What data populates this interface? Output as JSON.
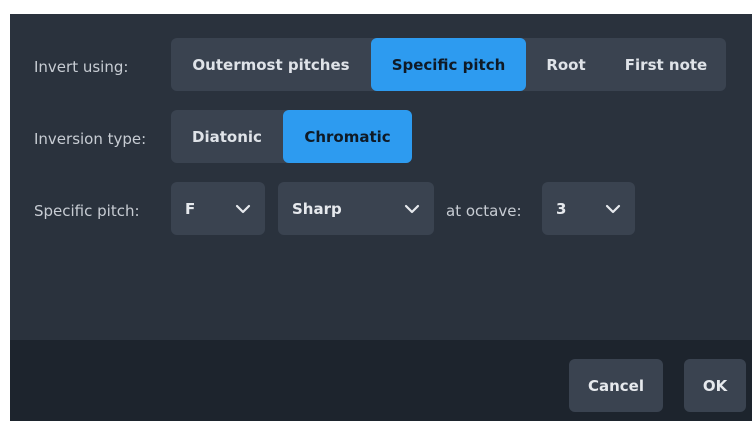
{
  "invert_using": {
    "label": "Invert using:",
    "options": [
      "Outermost pitches",
      "Specific pitch",
      "Root",
      "First note"
    ],
    "selected": "Specific pitch"
  },
  "inversion_type": {
    "label": "Inversion type:",
    "options": [
      "Diatonic",
      "Chromatic"
    ],
    "selected": "Chromatic"
  },
  "specific_pitch": {
    "label": "Specific pitch:",
    "note_value": "F",
    "accidental_value": "Sharp",
    "octave_label": "at octave:",
    "octave_value": "3"
  },
  "footer": {
    "cancel_label": "Cancel",
    "ok_label": "OK"
  },
  "colors": {
    "dialog_bg": "#2a323d",
    "footer_bg": "#1d242d",
    "control_bg": "#3a4350",
    "accent": "#2d9bf0"
  },
  "icons": {
    "dropdown": "chevron-down-icon"
  }
}
